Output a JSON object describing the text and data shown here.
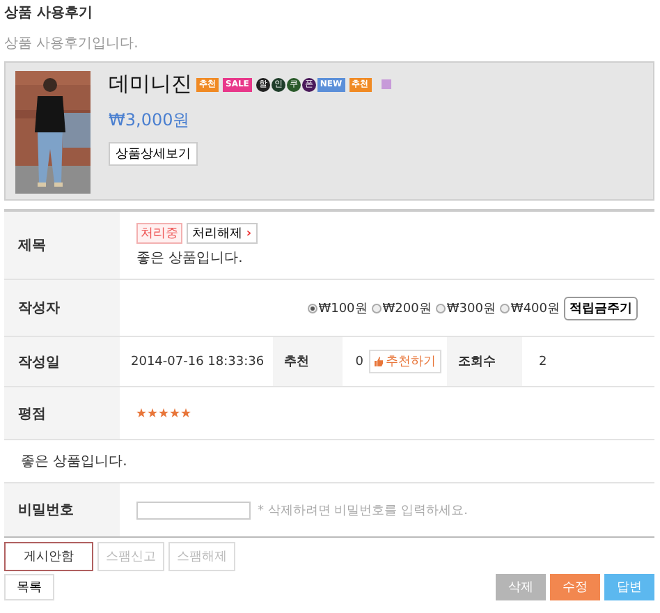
{
  "page_title": "상품 사용후기",
  "page_subtitle": "상품 사용후기입니다.",
  "product": {
    "name": "데미니진",
    "badges": [
      {
        "kind": "label",
        "text": "추천",
        "color": "#f08a24"
      },
      {
        "kind": "label",
        "text": "SALE",
        "color": "#e8388a"
      },
      {
        "kind": "circle",
        "text": "할",
        "color": "#222222"
      },
      {
        "kind": "circle",
        "text": "인",
        "color": "#1f3d2a"
      },
      {
        "kind": "circle",
        "text": "쿠",
        "color": "#2a5a2a"
      },
      {
        "kind": "circle",
        "text": "폰",
        "color": "#4a1a5a"
      },
      {
        "kind": "label",
        "text": "NEW",
        "color": "#5b8fd9"
      },
      {
        "kind": "label",
        "text": "추천",
        "color": "#f08a24"
      },
      {
        "kind": "square",
        "color": "#c79ad9"
      }
    ],
    "price": "₩3,000원",
    "detail_button": "상품상세보기"
  },
  "subject": {
    "label": "제목",
    "status": "처리중",
    "release_button": "처리해제",
    "release_arrow": "›",
    "text": "좋은 상품입니다."
  },
  "writer": {
    "label": "작성자",
    "points": [
      {
        "label": "₩100원",
        "selected": true
      },
      {
        "label": "₩200원",
        "selected": false
      },
      {
        "label": "₩300원",
        "selected": false
      },
      {
        "label": "₩400원",
        "selected": false
      }
    ],
    "give_button": "적립금주기"
  },
  "info": {
    "date_label": "작성일",
    "date": "2014-07-16 18:33:36",
    "recommend_label": "추천",
    "recommend_count": "0",
    "recommend_button": "추천하기",
    "views_label": "조회수",
    "views": "2"
  },
  "rating": {
    "label": "평점",
    "stars": 5
  },
  "content": "좋은 상품입니다.",
  "password": {
    "label": "비밀번호",
    "hint": "* 삭제하려면 비밀번호를 입력하세요."
  },
  "admin_buttons": [
    {
      "label": "게시안함",
      "disabled": false
    },
    {
      "label": "스팸신고",
      "disabled": true
    },
    {
      "label": "스팸해제",
      "disabled": true
    }
  ],
  "list_button": "목록",
  "action_buttons": [
    {
      "label": "삭제",
      "kind": "gray"
    },
    {
      "label": "수정",
      "kind": "orange"
    },
    {
      "label": "답변",
      "kind": "blue"
    }
  ]
}
